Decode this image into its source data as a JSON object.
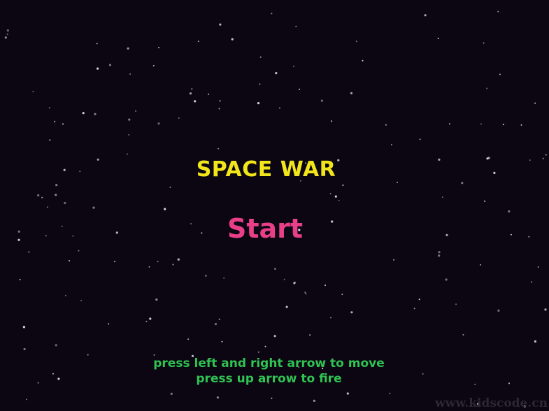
{
  "game": {
    "title": "SPACE WAR",
    "start_label": "Start",
    "instructions": {
      "line1": "press left and right arrow to move",
      "line2": "press up arrow to fire"
    },
    "watermark": "www.kidscode.cn"
  },
  "colors": {
    "background": "#0b0612",
    "title": "#f2e51a",
    "start": "#e83f88",
    "instructions": "#2fc452",
    "star": "#d8d8e8"
  },
  "scene": {
    "star_count": 180
  }
}
